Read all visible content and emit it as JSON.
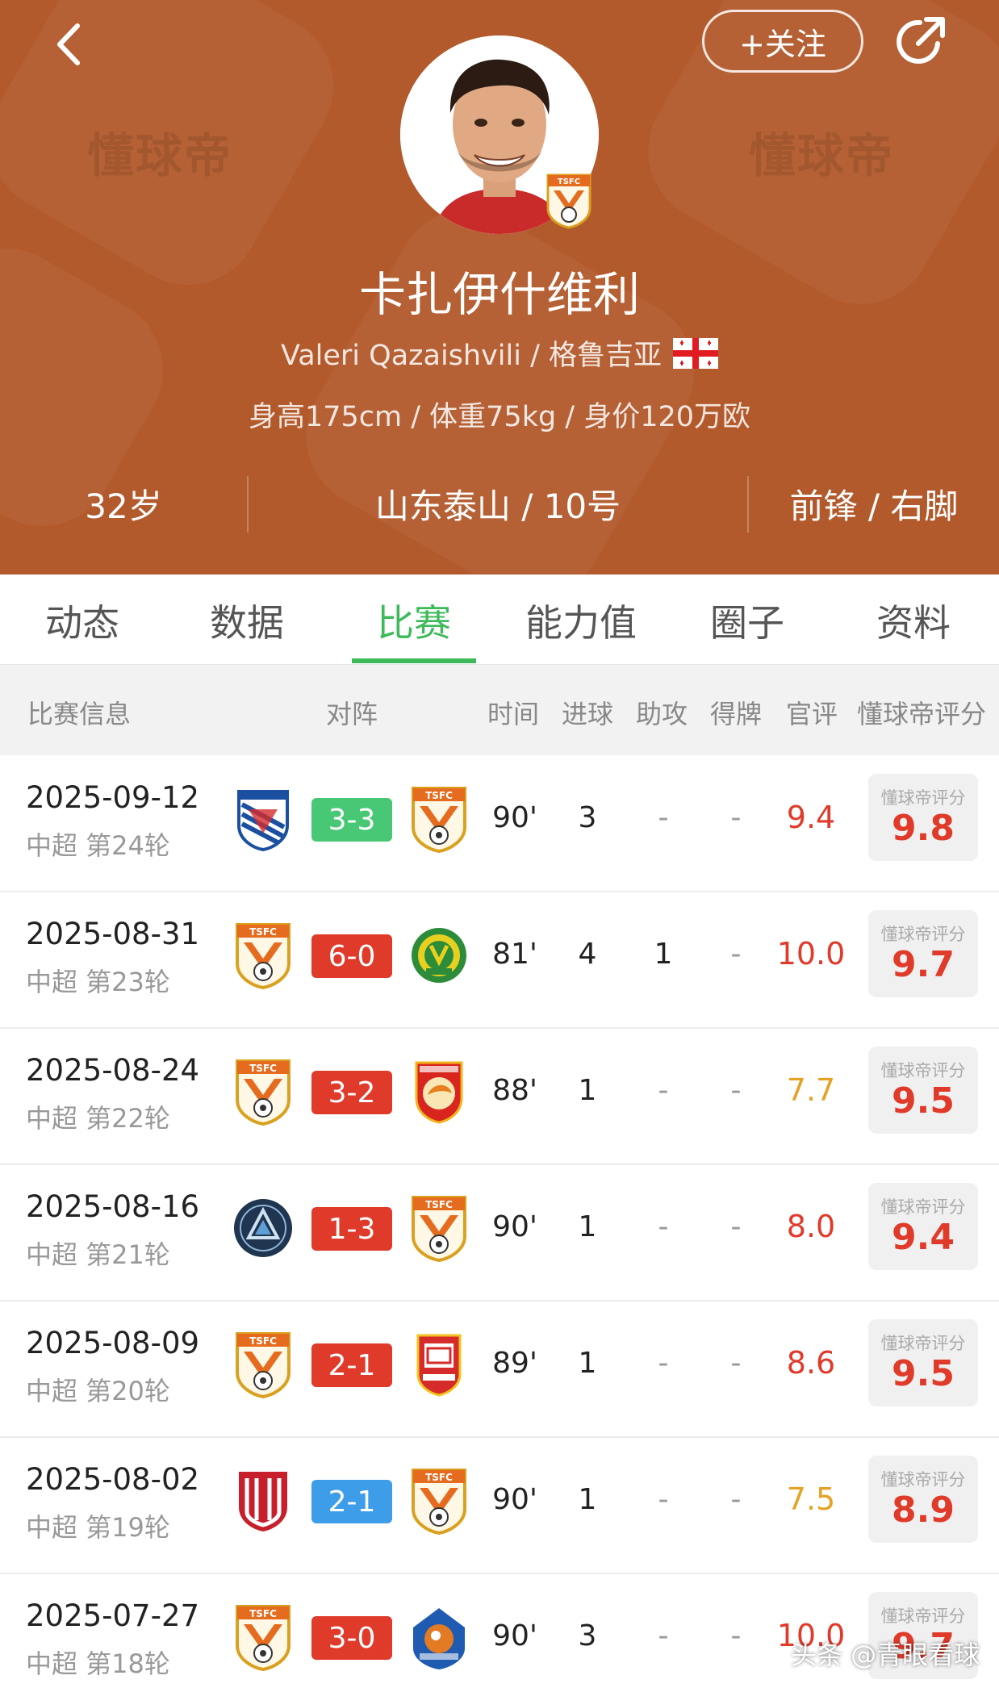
{
  "colors": {
    "header_bg": "#b35a2c",
    "active_tab": "#3cba5a",
    "score_win": "#e03a2a",
    "score_draw": "#48c774",
    "score_blue": "#3d9de8",
    "rating_red": "#e03a2a",
    "rating_yellow": "#e5a224"
  },
  "header": {
    "watermark": "懂球帝",
    "follow_label": "+关注",
    "player_name": "卡扎伊什维利",
    "english_name_country": "Valeri Qazaishvili / 格鲁吉亚",
    "body_info": "身高175cm / 体重75kg / 身价120万欧",
    "age": "32岁",
    "club_number": "山东泰山 / 10号",
    "position_foot": "前锋 / 右脚",
    "badge_text": "TSFC"
  },
  "tabs": [
    "动态",
    "数据",
    "比赛",
    "能力值",
    "圈子",
    "资料"
  ],
  "active_tab_index": 2,
  "table_header": {
    "info": "比赛信息",
    "matchup": "对阵",
    "time": "时间",
    "goals": "进球",
    "assists": "助攻",
    "cards": "得牌",
    "official": "官评",
    "dq_rating": "懂球帝评分"
  },
  "dq_label": "懂球帝评分",
  "matches": [
    {
      "date": "2025-09-12",
      "round": "中超 第24轮",
      "home": "shenhua-logo",
      "away": "tsfc-logo",
      "score": "3-3",
      "score_color": "#48c774",
      "time": "90'",
      "goals": "3",
      "assists": "-",
      "cards": "-",
      "official": "9.4",
      "official_color": "#e03a2a",
      "dq": "9.8"
    },
    {
      "date": "2025-08-31",
      "round": "中超 第23轮",
      "home": "tsfc-logo",
      "away": "guoan-logo",
      "score": "6-0",
      "score_color": "#e03a2a",
      "time": "81'",
      "goals": "4",
      "assists": "1",
      "cards": "-",
      "official": "10.0",
      "official_color": "#e03a2a",
      "dq": "9.7"
    },
    {
      "date": "2025-08-24",
      "round": "中超 第22轮",
      "home": "tsfc-logo",
      "away": "westcoast-logo",
      "score": "3-2",
      "score_color": "#e03a2a",
      "time": "88'",
      "goals": "1",
      "assists": "-",
      "cards": "-",
      "official": "7.7",
      "official_color": "#e5a224",
      "dq": "9.5"
    },
    {
      "date": "2025-08-16",
      "round": "中超 第21轮",
      "home": "shenzhen-peng-logo",
      "away": "tsfc-logo",
      "score": "1-3",
      "score_color": "#e03a2a",
      "time": "90'",
      "goals": "1",
      "assists": "-",
      "cards": "-",
      "official": "8.0",
      "official_color": "#e03a2a",
      "dq": "9.4"
    },
    {
      "date": "2025-08-09",
      "round": "中超 第20轮",
      "home": "tsfc-logo",
      "away": "changchun-logo",
      "score": "2-1",
      "score_color": "#e03a2a",
      "time": "89'",
      "goals": "1",
      "assists": "-",
      "cards": "-",
      "official": "8.6",
      "official_color": "#e03a2a",
      "dq": "9.5"
    },
    {
      "date": "2025-08-02",
      "round": "中超 第19轮",
      "home": "chengdu-logo",
      "away": "tsfc-logo",
      "score": "2-1",
      "score_color": "#3d9de8",
      "time": "90'",
      "goals": "1",
      "assists": "-",
      "cards": "-",
      "official": "7.5",
      "official_color": "#e5a224",
      "dq": "8.9"
    },
    {
      "date": "2025-07-27",
      "round": "中超 第18轮",
      "home": "tsfc-logo",
      "away": "meizhou-logo",
      "score": "3-0",
      "score_color": "#e03a2a",
      "time": "90'",
      "goals": "3",
      "assists": "-",
      "cards": "-",
      "official": "10.0",
      "official_color": "#e03a2a",
      "dq": "9.7"
    }
  ],
  "footer_watermark": "头条 @青眼看球"
}
